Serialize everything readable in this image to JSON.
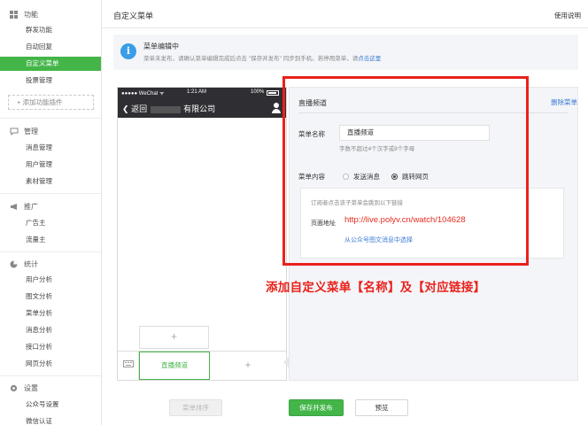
{
  "sidebar": {
    "sections": [
      {
        "title": "功能",
        "icon": "grid-icon"
      },
      {
        "title": "管理",
        "icon": "chat-bubble-icon"
      },
      {
        "title": "推广",
        "icon": "megaphone-icon"
      },
      {
        "title": "统计",
        "icon": "pie-chart-icon"
      },
      {
        "title": "设置",
        "icon": "gear-icon"
      }
    ],
    "function_items": [
      "群发功能",
      "自动回复",
      "自定义菜单",
      "投票管理"
    ],
    "add_plugin": "+ 添加功能插件",
    "manage_items": [
      "消息管理",
      "用户管理",
      "素材管理"
    ],
    "promote_items": [
      "广告主",
      "流量主"
    ],
    "stats_items": [
      "用户分析",
      "图文分析",
      "菜单分析",
      "消息分析",
      "接口分析",
      "网页分析"
    ],
    "settings_items": [
      "公众号设置",
      "微信认证"
    ]
  },
  "header": {
    "title": "自定义菜单",
    "help": "使用说明"
  },
  "notice": {
    "title": "菜单编辑中",
    "body": "菜单未发布，请确认菜单编辑完成后点击 \"保存并发布\" 同步到手机。若停用菜单，请",
    "link": "点击这里"
  },
  "phone": {
    "carrier": "●●●●● WeChat ᯤ",
    "time": "1:21 AM",
    "battery": "100%",
    "back_label": "返回",
    "account_suffix": "有限公司",
    "submenu_add": "+",
    "menu_tab": "直播频道",
    "menu_add": "+",
    "keyboard_icon": "keyboard-icon"
  },
  "editor": {
    "title": "直播频道",
    "delete": "删除菜单",
    "name_label": "菜单名称",
    "name_value": "直播频道",
    "name_hint": "字数不超过4个汉字或8个字母",
    "content_label": "菜单内容",
    "option_send": "发送消息",
    "option_jump": "跳转网页",
    "content_hint": "订阅者点击该子菜单会跳到以下链接",
    "url_label": "页面地址",
    "url_value": "http://live.polyv.cn/watch/104628",
    "pick_link": "从公众号图文消息中选择"
  },
  "annotation": "添加自定义菜单【名称】及【对应链接】",
  "buttons": {
    "sort": "菜单排序",
    "save": "保存并发布",
    "preview": "预览"
  },
  "colors": {
    "accent_green": "#44b549",
    "annotation_red": "#e8221b",
    "link_blue": "#3a7bd5",
    "phone_bar": "#2e2e33"
  }
}
